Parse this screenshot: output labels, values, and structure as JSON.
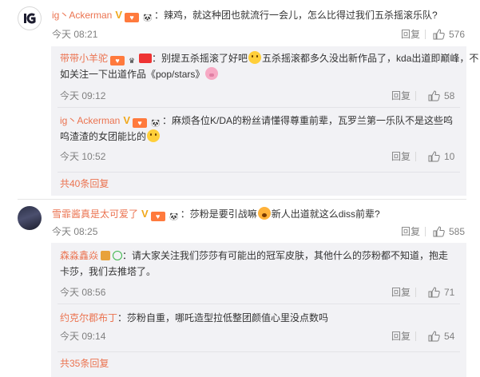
{
  "comments": [
    {
      "user": "ig丶Ackerman",
      "text": "辣鸡，就这种团也就流行一会儿，怎么比得过我们五杀摇滚乐队?",
      "time": "今天 08:21",
      "reply_label": "回复",
      "likes": "576",
      "sub_replies": [
        {
          "user": "带带小羊驼",
          "text_a": "别提五杀摇滚了好吧",
          "text_b": "五杀摇滚都多久没出新作品了，kda出道即巅峰，不",
          "text_c": "如关注一下出道作品《pop/stars》",
          "time": "今天 09:12",
          "reply_label": "回复",
          "likes": "58"
        },
        {
          "user": "ig丶Ackerman",
          "text_a": "麻烦各位K/DA的粉丝请懂得尊重前辈，瓦罗兰第一乐队不是这些呜",
          "text_b": "呜渣渣的女团能比的",
          "time": "今天 10:52",
          "reply_label": "回复",
          "likes": "10"
        }
      ],
      "more_link": "共40条回复"
    },
    {
      "user": "雪霏酱真是太可爱了",
      "text_a": "莎粉是要引战嘛",
      "text_b": "新人出道就这么diss前辈?",
      "time": "今天 08:25",
      "reply_label": "回复",
      "likes": "585",
      "sub_replies": [
        {
          "user": "森淼鑫焱",
          "text_a": "请大家关注我们莎莎有可能出的冠军皮肤，其他什么的莎粉都不知道，抱走",
          "text_b": "卡莎，我们去推塔了。",
          "time": "今天 08:56",
          "reply_label": "回复",
          "likes": "71"
        },
        {
          "user": "约克尔郡布丁",
          "text": "莎粉自重，哪吒造型拉低整团颜值心里没点数吗",
          "time": "今天 09:14",
          "reply_label": "回复",
          "likes": "54"
        }
      ],
      "more_link": "共35条回复"
    }
  ],
  "colors": {
    "username": "#eb7350",
    "meta": "#808080",
    "sub_background": "#f2f2f5",
    "vip_badge": "#f0a81b"
  },
  "icons": [
    "ig-team-avatar",
    "user-avatar",
    "vip-badge-icon",
    "fan-badge-icon",
    "panda-badge-icon",
    "thumbs-up-icon",
    "emoji-face-icon",
    "emoji-pig-icon"
  ]
}
